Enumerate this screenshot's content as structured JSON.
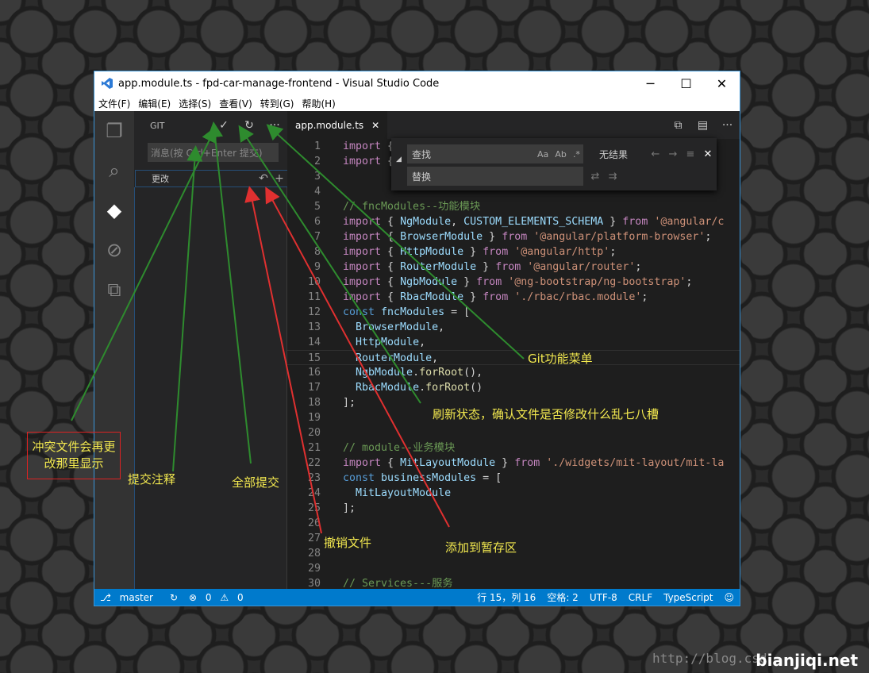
{
  "window": {
    "title": "app.module.ts - fpd-car-manage-frontend - Visual Studio Code"
  },
  "menu": [
    "文件(F)",
    "编辑(E)",
    "选择(S)",
    "查看(V)",
    "转到(G)",
    "帮助(H)"
  ],
  "activity": [
    "files-icon",
    "search-icon",
    "git-icon",
    "debug-icon",
    "extensions-icon"
  ],
  "sidebar": {
    "title": "GIT",
    "commit_placeholder": "消息(按 Ctrl+Enter 提交)",
    "changes_label": "更改"
  },
  "editor": {
    "tab": "app.module.ts",
    "find": {
      "find_placeholder": "查找",
      "replace_placeholder": "替换",
      "no_results": "无结果"
    }
  },
  "code_lines": [
    {
      "n": "1",
      "t": "import {"
    },
    {
      "n": "2",
      "t": "import {"
    },
    {
      "n": "3",
      "t": ""
    },
    {
      "n": "4",
      "t": ""
    },
    {
      "n": "5",
      "t": "// fncModules--功能模块"
    },
    {
      "n": "6",
      "t": "import { NgModule, CUSTOM_ELEMENTS_SCHEMA } from '@angular/c"
    },
    {
      "n": "7",
      "t": "import { BrowserModule } from '@angular/platform-browser';"
    },
    {
      "n": "8",
      "t": "import { HttpModule } from '@angular/http';"
    },
    {
      "n": "9",
      "t": "import { RouterModule } from '@angular/router';"
    },
    {
      "n": "10",
      "t": "import { NgbModule } from '@ng-bootstrap/ng-bootstrap';"
    },
    {
      "n": "11",
      "t": "import { RbacModule } from './rbac/rbac.module';"
    },
    {
      "n": "12",
      "t": "const fncModules = ["
    },
    {
      "n": "13",
      "t": "  BrowserModule,"
    },
    {
      "n": "14",
      "t": "  HttpModule,"
    },
    {
      "n": "15",
      "t": "  RouterModule,"
    },
    {
      "n": "16",
      "t": "  NgbModule.forRoot(),"
    },
    {
      "n": "17",
      "t": "  RbacModule.forRoot()"
    },
    {
      "n": "18",
      "t": "];"
    },
    {
      "n": "19",
      "t": ""
    },
    {
      "n": "20",
      "t": ""
    },
    {
      "n": "21",
      "t": "// module--业务模块"
    },
    {
      "n": "22",
      "t": "import { MitLayoutModule } from './widgets/mit-layout/mit-la"
    },
    {
      "n": "23",
      "t": "const businessModules = ["
    },
    {
      "n": "24",
      "t": "  MitLayoutModule"
    },
    {
      "n": "25",
      "t": "];"
    },
    {
      "n": "26",
      "t": ""
    },
    {
      "n": "27",
      "t": ""
    },
    {
      "n": "28",
      "t": ""
    },
    {
      "n": "29",
      "t": ""
    },
    {
      "n": "30",
      "t": "// Services---服务"
    }
  ],
  "status": {
    "branch": "master",
    "errors": "0",
    "warnings": "0",
    "position": "行 15，列 16",
    "spaces": "空格: 2",
    "encoding": "UTF-8",
    "eol": "CRLF",
    "language": "TypeScript"
  },
  "annotations": {
    "git_menu": "Git功能菜单",
    "refresh": "刷新状态，确认文件是否修改什么乱七八槽",
    "conflict": "冲突文件会再更改那里显示",
    "commit_msg": "提交注释",
    "commit_all": "全部提交",
    "discard": "撤销文件",
    "stage": "添加到暂存区"
  },
  "watermark": {
    "url": "http://blog.csd",
    "brand": "bianjiqi.net"
  },
  "colors": {
    "accent": "#007acc",
    "arrow_green": "#2e8b2e",
    "arrow_red": "#e03030",
    "note_yellow": "#f2e84f"
  }
}
